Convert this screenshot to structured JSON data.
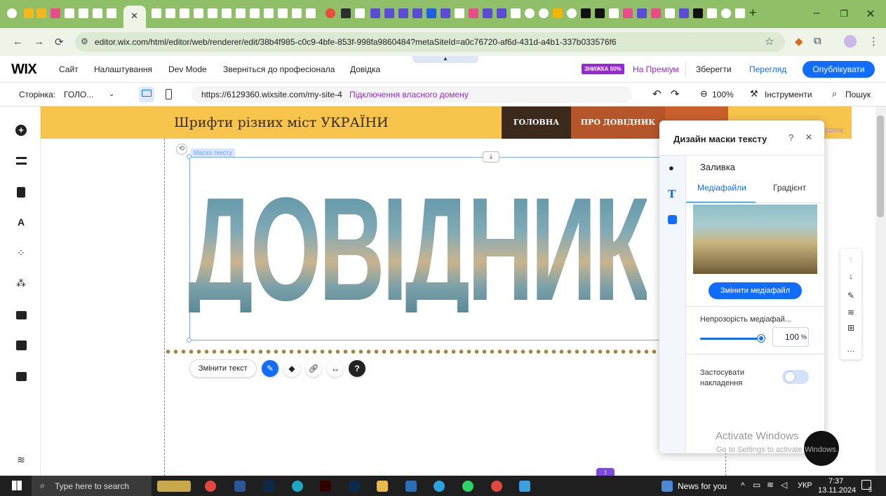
{
  "browser": {
    "url": "editor.wix.com/html/editor/web/renderer/edit/38b4f985-c0c9-4bfe-853f-998fa9860484?metaSiteId=a0c76720-af6d-431d-a4b1-337b033576f6"
  },
  "wix_bar": {
    "logo": "WIX",
    "menu": [
      "Сайт",
      "Налаштування",
      "Dev Mode",
      "Зверніться до професіонала",
      "Довідка"
    ],
    "promo_badge": "ЗНИЖКА 50%",
    "promo_link": "На Преміум",
    "save": "Зберегти",
    "preview": "Перегляд",
    "publish": "Опублікувати"
  },
  "page_bar": {
    "page_label": "Сторінка:",
    "page_name": "ГОЛО...",
    "site_url": "https://6129360.wixsite.com/my-site-4",
    "connect_domain": "Підключення власного домену",
    "zoom": "100%",
    "tools": "Інструменти",
    "search": "Пошук"
  },
  "site": {
    "title": "Шрифти різних міст УКРАЇНИ",
    "nav": [
      "ГОЛОВНА",
      "ПРО ДОВІДНИК"
    ],
    "welcome_fragment": "come",
    "mask_label": "Маска тексту",
    "mask_text": "ДОВІДНИК",
    "change_text": "Змінити текст"
  },
  "panel": {
    "title": "Дизайн маски тексту",
    "help": "?",
    "close": "×",
    "section": "Заливка",
    "tabs": [
      "Медіафайли",
      "Градієнт"
    ],
    "change_media": "Змінити медіафайл",
    "opacity_label": "Непрозорість медіафай...",
    "opacity_value": "100",
    "opacity_unit": "%",
    "overlay_label": "Застосувати накладення"
  },
  "watermark": {
    "line1": "Activate Windows",
    "line2": "Go to Settings to activate Windows."
  },
  "taskbar": {
    "search_placeholder": "Type here to search",
    "news": "News for you",
    "lang": "УКР",
    "time": "7:37",
    "date": "13.11.2024",
    "notif_count": "5"
  },
  "colors": {
    "wix_blue": "#116dff",
    "header_yellow": "#f7c44c",
    "nav_dark": "#3b2a1c",
    "nav_brown": "#b5552a",
    "browser_green": "#8fbf67",
    "promo_purple": "#9a27d5"
  }
}
